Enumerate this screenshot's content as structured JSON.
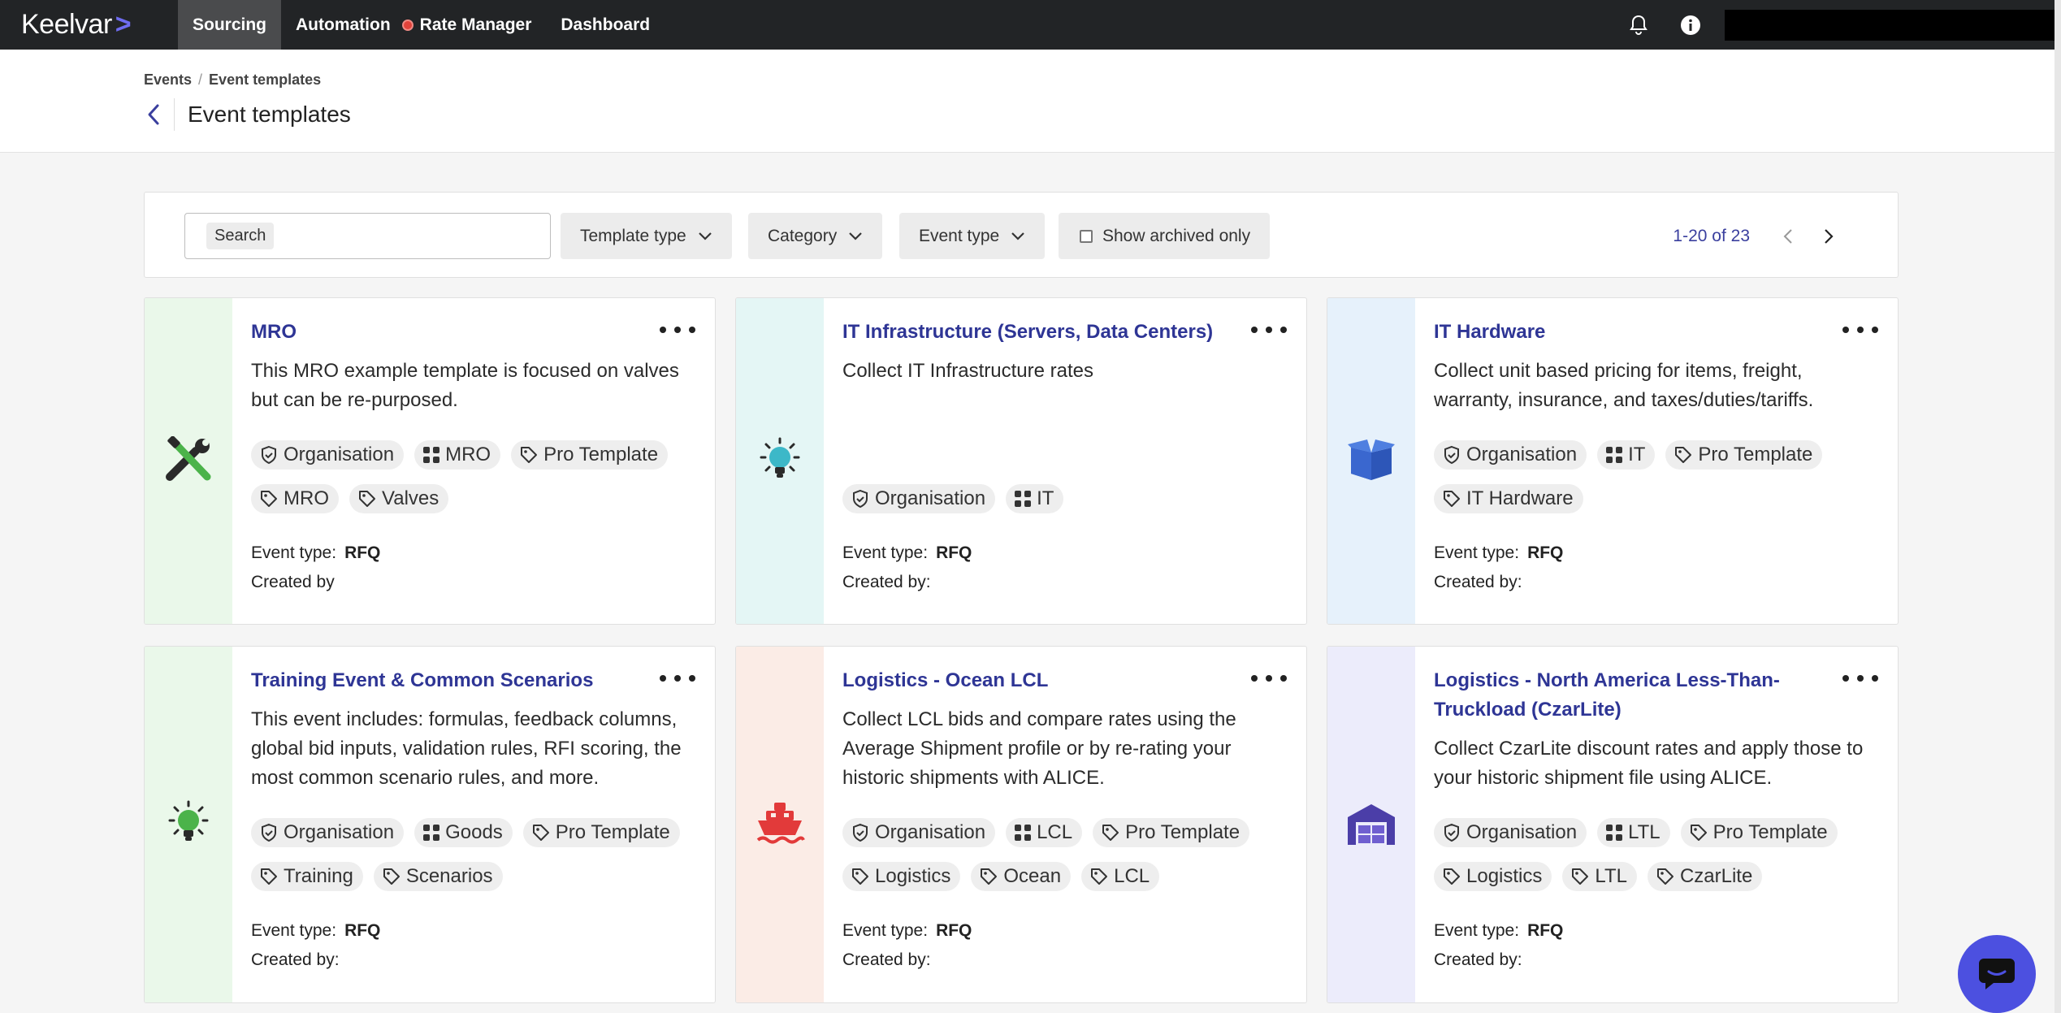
{
  "app": {
    "logo_text": "Keelvar",
    "logo_chevron": ">"
  },
  "nav": {
    "items": [
      {
        "label": "Sourcing",
        "active": true
      },
      {
        "label": "Automation"
      },
      {
        "label": "Rate Manager",
        "has_status_dot": true
      },
      {
        "label": "Dashboard"
      }
    ],
    "right_icons": [
      "bell-icon",
      "info-icon"
    ]
  },
  "breadcrumb": {
    "root": "Events",
    "separator": "/",
    "current": "Event templates"
  },
  "page": {
    "title": "Event templates"
  },
  "filters": {
    "search_chip": "Search",
    "template_type": "Template type",
    "category": "Category",
    "event_type": "Event type",
    "show_archived": "Show archived only",
    "pagination": "1-20 of 23"
  },
  "labels": {
    "event_type": "Event type:",
    "created_by": "Created by:",
    "created_by_short": "Created by"
  },
  "cards": [
    {
      "title": "MRO",
      "description": "This MRO example template is focused on valves but can be re-purposed.",
      "tags": [
        {
          "kind": "org",
          "label": "Organisation"
        },
        {
          "kind": "category",
          "label": "MRO"
        },
        {
          "kind": "label",
          "label": "Pro Template"
        },
        {
          "kind": "label",
          "label": "MRO"
        },
        {
          "kind": "label",
          "label": "Valves"
        }
      ],
      "event_type": "RFQ",
      "icon": "tools-icon",
      "accent": "#eaf8ea"
    },
    {
      "title": "IT Infrastructure (Servers, Data Centers)",
      "description": "Collect IT Infrastructure rates",
      "tags": [
        {
          "kind": "org",
          "label": "Organisation"
        },
        {
          "kind": "category",
          "label": "IT"
        }
      ],
      "event_type": "RFQ",
      "icon": "lightbulb-icon",
      "accent": "#e4f6f5"
    },
    {
      "title": "IT Hardware",
      "description": "Collect unit based pricing for items, freight, warranty, insurance, and taxes/duties/tariffs.",
      "tags": [
        {
          "kind": "org",
          "label": "Organisation"
        },
        {
          "kind": "category",
          "label": "IT"
        },
        {
          "kind": "label",
          "label": "Pro Template"
        },
        {
          "kind": "label",
          "label": "IT Hardware"
        }
      ],
      "event_type": "RFQ",
      "icon": "box-icon",
      "accent": "#e6f1fb"
    },
    {
      "title": "Training Event & Common Scenarios",
      "description": "This event includes: formulas, feedback columns, global bid inputs, validation rules, RFI scoring, the most common scenario rules, and more.",
      "tags": [
        {
          "kind": "org",
          "label": "Organisation"
        },
        {
          "kind": "category",
          "label": "Goods"
        },
        {
          "kind": "label",
          "label": "Pro Template"
        },
        {
          "kind": "label",
          "label": "Training"
        },
        {
          "kind": "label",
          "label": "Scenarios"
        }
      ],
      "event_type": "RFQ",
      "icon": "lightbulb-icon",
      "accent": "#eaf8ea"
    },
    {
      "title": "Logistics - Ocean LCL",
      "description": "Collect LCL bids and compare rates using the Average Shipment profile or by re-rating your historic shipments with ALICE.",
      "tags": [
        {
          "kind": "org",
          "label": "Organisation"
        },
        {
          "kind": "category",
          "label": "LCL"
        },
        {
          "kind": "label",
          "label": "Pro Template"
        },
        {
          "kind": "label",
          "label": "Logistics"
        },
        {
          "kind": "label",
          "label": "Ocean"
        },
        {
          "kind": "label",
          "label": "LCL"
        }
      ],
      "event_type": "RFQ",
      "icon": "ship-icon",
      "accent": "#fbece6"
    },
    {
      "title": "Logistics - North America Less-Than-Truckload (CzarLite)",
      "description": "Collect CzarLite discount rates and apply those to your historic shipment file using ALICE.",
      "tags": [
        {
          "kind": "org",
          "label": "Organisation"
        },
        {
          "kind": "category",
          "label": "LTL"
        },
        {
          "kind": "label",
          "label": "Pro Template"
        },
        {
          "kind": "label",
          "label": "Logistics"
        },
        {
          "kind": "label",
          "label": "LTL"
        },
        {
          "kind": "label",
          "label": "CzarLite"
        }
      ],
      "event_type": "RFQ",
      "icon": "warehouse-icon",
      "accent": "#ececfb"
    }
  ]
}
